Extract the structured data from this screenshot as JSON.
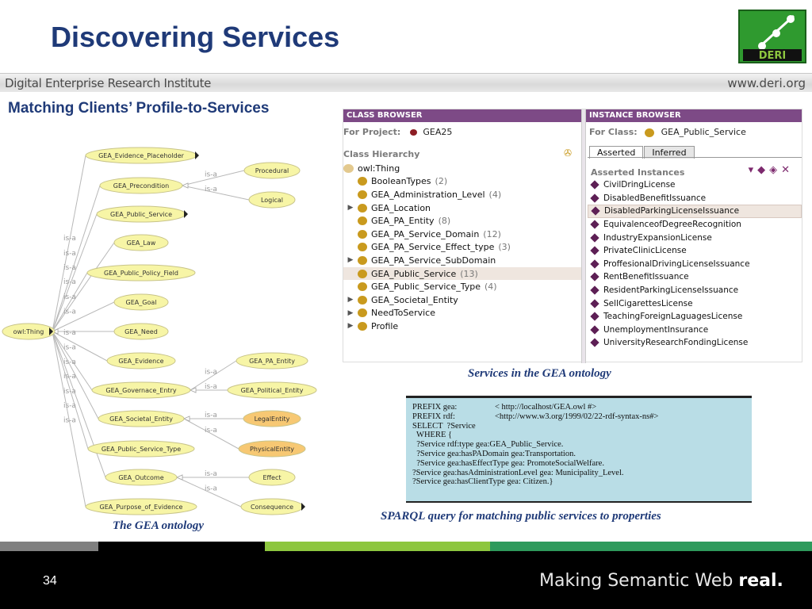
{
  "slide": {
    "title": "Discovering Services",
    "institute": "Digital Enterprise Research Institute",
    "url": "www.deri.org",
    "subtitle": "Matching Clients’ Profile-to-Services",
    "logo_text": "DERI",
    "page_number": "34",
    "tagline_prefix": "Making Semantic Web ",
    "tagline_emphasis": "real."
  },
  "ontology": {
    "root": "owl:Thing",
    "edge_label": "is-a",
    "nodes": [
      "GEA_Evidence_Placeholder",
      "GEA_Precondition",
      "GEA_Public_Service",
      "GEA_Law",
      "GEA_Public_Policy_Field",
      "GEA_Goal",
      "GEA_Need",
      "GEA_Evidence",
      "GEA_Governace_Entry",
      "GEA_Societal_Entity",
      "GEA_Public_Service_Type",
      "GEA_Outcome",
      "GEA_Purpose_of_Evidence"
    ],
    "leaves": [
      "Procedural",
      "Logical",
      "GEA_PA_Entity",
      "GEA_Political_Entity",
      "LegalEntity",
      "PhysicalEntity",
      "Effect",
      "Consequence"
    ],
    "caption": "The GEA ontology"
  },
  "class_browser": {
    "header": "CLASS BROWSER",
    "project_label": "For Project:",
    "project": "GEA25",
    "hierarchy_label": "Class Hierarchy",
    "root": "owl:Thing",
    "classes": [
      {
        "name": "BooleanTypes",
        "count": "(2)",
        "expand": false,
        "selected": false
      },
      {
        "name": "GEA_Administration_Level",
        "count": "(4)",
        "expand": false,
        "selected": false
      },
      {
        "name": "GEA_Location",
        "count": "",
        "expand": true,
        "selected": false
      },
      {
        "name": "GEA_PA_Entity",
        "count": "(8)",
        "expand": false,
        "selected": false
      },
      {
        "name": "GEA_PA_Service_Domain",
        "count": "(12)",
        "expand": false,
        "selected": false
      },
      {
        "name": "GEA_PA_Service_Effect_type",
        "count": "(3)",
        "expand": false,
        "selected": false
      },
      {
        "name": "GEA_PA_Service_SubDomain",
        "count": "",
        "expand": true,
        "selected": false
      },
      {
        "name": "GEA_Public_Service",
        "count": "(13)",
        "expand": false,
        "selected": true
      },
      {
        "name": "GEA_Public_Service_Type",
        "count": "(4)",
        "expand": false,
        "selected": false
      },
      {
        "name": "GEA_Societal_Entity",
        "count": "",
        "expand": true,
        "selected": false
      },
      {
        "name": "NeedToService",
        "count": "",
        "expand": true,
        "selected": false
      },
      {
        "name": "Profile",
        "count": "",
        "expand": true,
        "selected": false
      }
    ]
  },
  "instance_browser": {
    "header": "INSTANCE BROWSER",
    "class_label": "For Class:",
    "class": "GEA_Public_Service",
    "tab_asserted": "Asserted",
    "tab_inferred": "Inferred",
    "asserted_label": "Asserted Instances",
    "instances": [
      "CivilDringLicense",
      "DisabledBenefitIssuance",
      "DisabledParkingLicenseIssuance",
      "EquivalenceofDegreeRecognition",
      "IndustryExpansionLicense",
      "PrivateClinicLicense",
      "ProffesionalDrivingLicenseIssuance",
      "RentBenefitIssuance",
      "ResidentParkingLicenseIssuance",
      "SellCigarettesLicense",
      "TeachingForeignLaguagesLicense",
      "UnemploymentInsurance",
      "UniversityResearchFondingLicense"
    ],
    "selected_index": 2,
    "caption": "Services in the GEA ontology"
  },
  "sparql": {
    "prefix1_key": "PREFIX gea:",
    "prefix1_val": "< http://localhost/GEA.owl #>",
    "prefix2_key": "PREFIX rdf:",
    "prefix2_val": "<http://www.w3.org/1999/02/22-rdf-syntax-ns#>",
    "lines": [
      "SELECT  ?Service",
      "  WHERE {",
      "  ?Service rdf:type gea:GEA_Public_Service.",
      "  ?Service gea:hasPADomain gea:Transportation.",
      "  ?Service gea:hasEffectType gea: PromoteSocialWelfare.",
      "?Service gea:hasAdministrationLevel gea: Municipality_Level.",
      "?Service gea:hasClientType gea: Citizen.}"
    ],
    "caption": "SPARQL query for matching public services to properties"
  },
  "colors": {
    "title": "#1f3a78",
    "node_fill": "#f7f5a6",
    "node_orange": "#f7c873",
    "protege_header": "#7d4a86",
    "sparql_bg": "#b9dde6",
    "bar_gray": "#808080",
    "bar_green": "#8dc63f",
    "bar_teal": "#2e9a5c"
  }
}
